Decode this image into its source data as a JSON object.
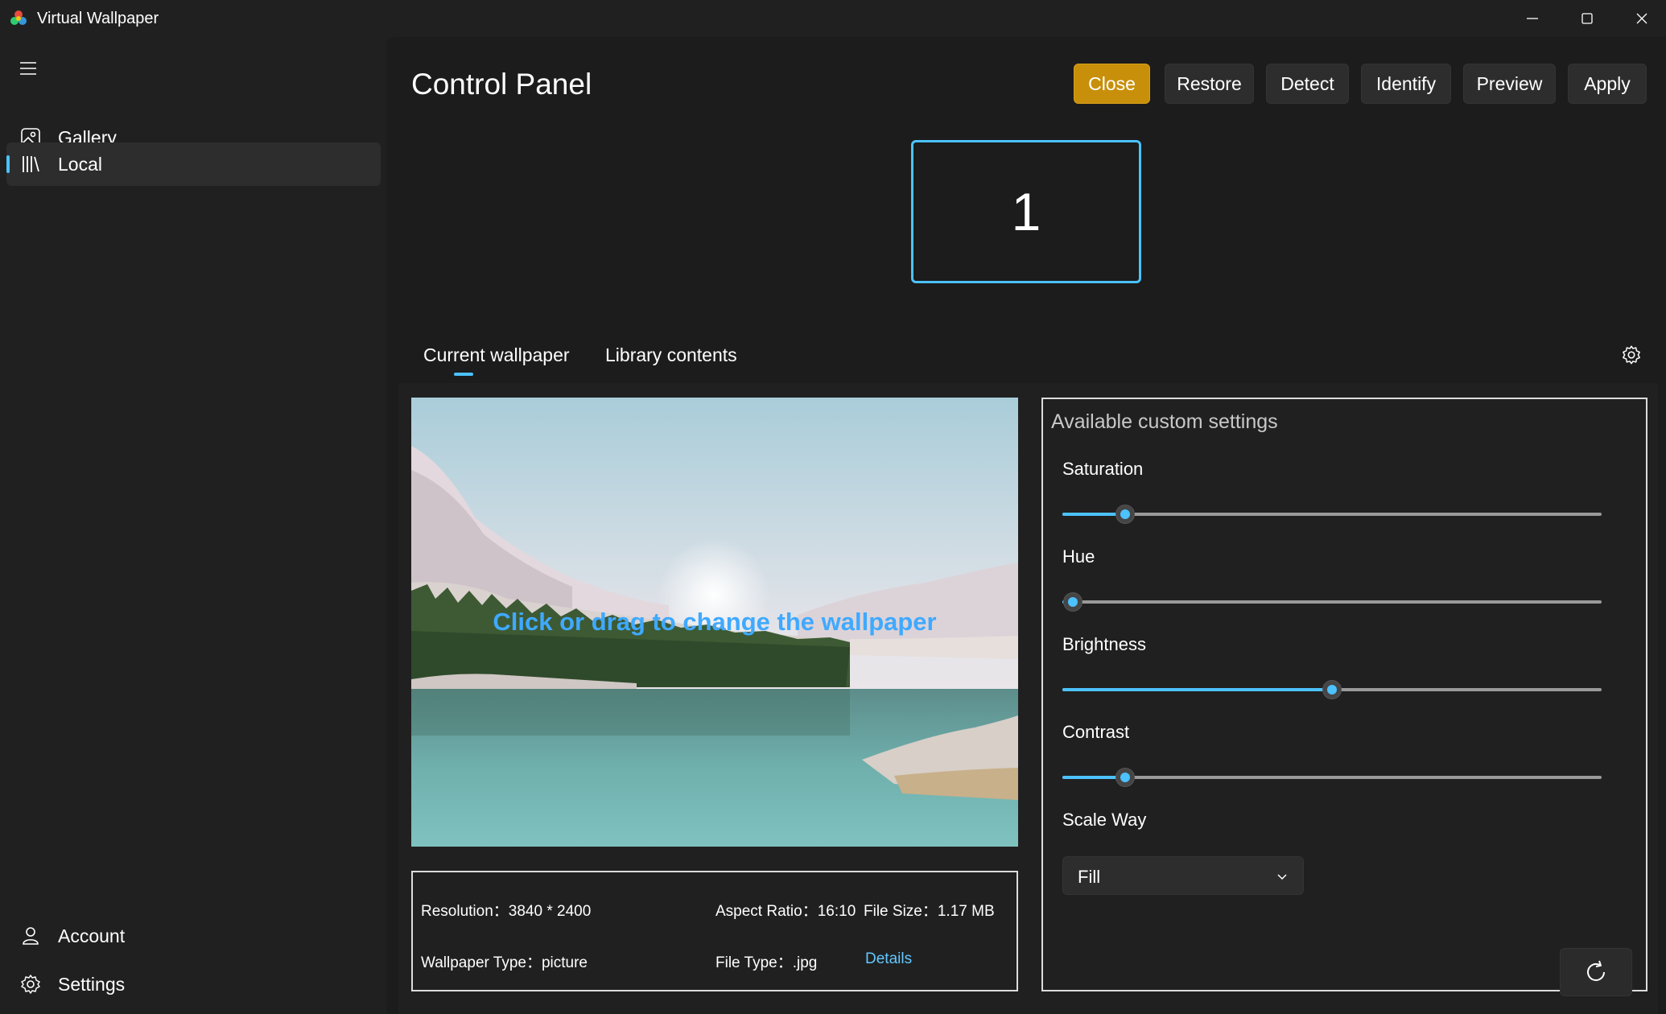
{
  "window": {
    "title": "Virtual Wallpaper",
    "icons": {
      "app": "app-logo-icon",
      "minimize": "minimize-icon",
      "maximize": "maximize-icon",
      "close": "close-icon"
    }
  },
  "sidebar": {
    "items": [
      {
        "label": "Gallery",
        "icon": "gallery-icon",
        "selected": false
      },
      {
        "label": "Local",
        "icon": "library-icon",
        "selected": true
      }
    ],
    "footer": [
      {
        "label": "Account",
        "icon": "person-icon"
      },
      {
        "label": "Settings",
        "icon": "gear-icon"
      }
    ]
  },
  "header": {
    "title": "Control Panel",
    "buttons": [
      "Close",
      "Restore",
      "Detect",
      "Identify",
      "Preview",
      "Apply"
    ]
  },
  "monitor": {
    "label": "1"
  },
  "tabs": {
    "items": [
      "Current wallpaper",
      "Library contents"
    ],
    "selected": 0
  },
  "wallpaper": {
    "hint": "Click or drag to change the wallpaper"
  },
  "info": {
    "resolution": "Resolution：3840 * 2400",
    "aspect_ratio": "Aspect Ratio：16:10",
    "file_size": "File Size：1.17 MB",
    "wallpaper_type": "Wallpaper Type：picture",
    "file_type": "File Type：.jpg",
    "details_link": "Details"
  },
  "custom_settings": {
    "header": "Available custom settings",
    "sliders": [
      {
        "label": "Saturation",
        "value": 0.117
      },
      {
        "label": "Hue",
        "value": 0.02
      },
      {
        "label": "Brightness",
        "value": 0.5
      },
      {
        "label": "Contrast",
        "value": 0.117
      }
    ],
    "scale_way": {
      "label": "Scale Way",
      "value": "Fill"
    }
  },
  "colors": {
    "accent": "#4cc2ff",
    "close_button": "#c8900a",
    "background": "#202020"
  }
}
